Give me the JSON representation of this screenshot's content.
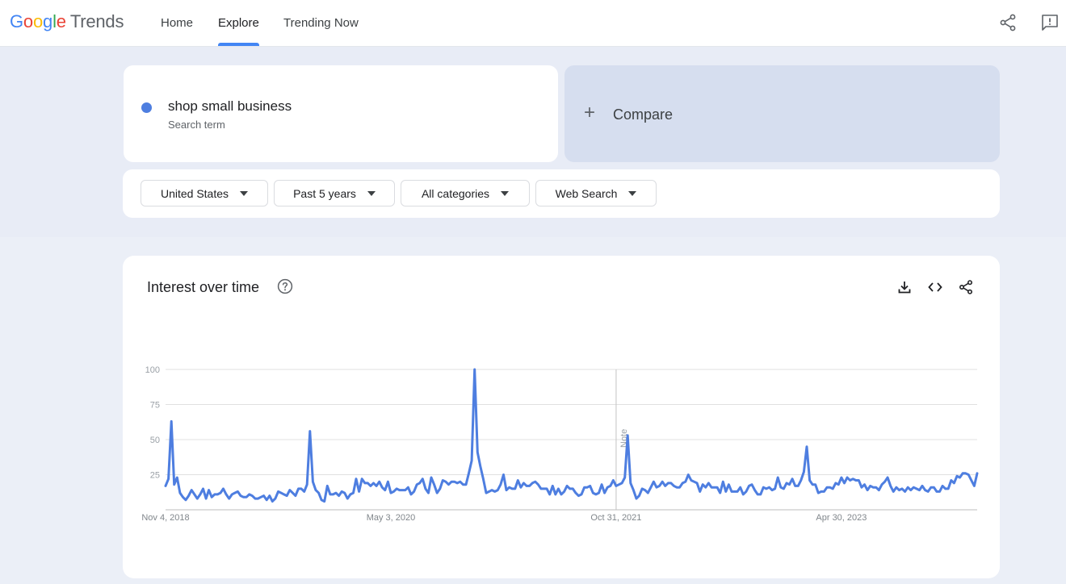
{
  "app": {
    "logo": {
      "google": [
        "G",
        "o",
        "o",
        "g",
        "l",
        "e"
      ],
      "product": "Trends"
    },
    "nav": [
      {
        "label": "Home",
        "active": false
      },
      {
        "label": "Explore",
        "active": true
      },
      {
        "label": "Trending Now",
        "active": false
      }
    ],
    "icons": {
      "share": "share-icon",
      "feedback": "feedback-icon"
    }
  },
  "search": {
    "term": "shop small business",
    "term_type": "Search term",
    "term_color": "#4e7ee0",
    "compare_label": "Compare",
    "compare_icon": "+"
  },
  "filters": [
    {
      "label": "United States"
    },
    {
      "label": "Past 5 years"
    },
    {
      "label": "All categories"
    },
    {
      "label": "Web Search"
    }
  ],
  "interest_card": {
    "title": "Interest over time",
    "icons": [
      "help-icon",
      "download-icon",
      "embed-icon",
      "share-icon"
    ],
    "note_label": "Note"
  },
  "chart_data": {
    "type": "line",
    "title": "Interest over time",
    "xlabel": "",
    "ylabel": "",
    "ylim": [
      0,
      100
    ],
    "yticks": [
      25,
      50,
      75,
      100
    ],
    "grid": true,
    "line_color": "#4e7ee0",
    "x_tick_labels": [
      "Nov 4, 2018",
      "May 3, 2020",
      "Oct 31, 2021",
      "Apr 30, 2023"
    ],
    "note_at_week": 156,
    "series": [
      {
        "values": [
          17,
          22,
          63,
          18,
          23,
          12,
          9,
          7,
          10,
          14,
          11,
          8,
          11,
          15,
          8,
          14,
          9,
          11,
          11,
          12,
          15,
          11,
          8,
          11,
          12,
          13,
          10,
          9,
          9,
          11,
          10,
          8,
          8,
          9,
          10,
          7,
          10,
          6,
          8,
          13,
          12,
          11,
          10,
          14,
          12,
          10,
          15,
          15,
          13,
          18,
          56,
          20,
          14,
          12,
          7,
          6,
          17,
          11,
          11,
          12,
          10,
          13,
          12,
          8,
          11,
          12,
          22,
          13,
          22,
          19,
          19,
          17,
          19,
          17,
          20,
          16,
          14,
          20,
          12,
          13,
          15,
          14,
          14,
          14,
          16,
          11,
          13,
          18,
          19,
          22,
          15,
          12,
          23,
          18,
          12,
          15,
          21,
          20,
          18,
          20,
          20,
          19,
          20,
          18,
          18,
          26,
          35,
          100,
          41,
          31,
          22,
          12,
          13,
          14,
          13,
          14,
          18,
          25,
          14,
          16,
          15,
          15,
          21,
          16,
          19,
          17,
          17,
          19,
          20,
          18,
          15,
          15,
          15,
          11,
          17,
          11,
          15,
          11,
          13,
          17,
          15,
          15,
          12,
          10,
          11,
          16,
          16,
          17,
          12,
          11,
          12,
          18,
          12,
          16,
          17,
          21,
          17,
          18,
          19,
          23,
          53,
          19,
          14,
          8,
          10,
          15,
          14,
          12,
          16,
          20,
          16,
          17,
          20,
          17,
          19,
          19,
          17,
          16,
          16,
          19,
          20,
          25,
          21,
          20,
          19,
          13,
          18,
          16,
          19,
          16,
          16,
          16,
          12,
          20,
          13,
          18,
          13,
          13,
          13,
          16,
          11,
          13,
          17,
          18,
          14,
          11,
          11,
          16,
          15,
          16,
          14,
          15,
          23,
          16,
          15,
          19,
          18,
          22,
          17,
          17,
          21,
          27,
          45,
          21,
          18,
          18,
          12,
          13,
          13,
          16,
          16,
          15,
          19,
          18,
          23,
          19,
          23,
          21,
          22,
          21,
          21,
          16,
          18,
          14,
          17,
          16,
          16,
          14,
          18,
          20,
          23,
          17,
          13,
          16,
          14,
          15,
          13,
          16,
          14,
          16,
          15,
          14,
          17,
          14,
          13,
          16,
          16,
          13,
          13,
          17,
          15,
          15,
          21,
          19,
          24,
          23,
          26,
          26,
          25,
          21,
          17,
          26
        ]
      }
    ]
  }
}
